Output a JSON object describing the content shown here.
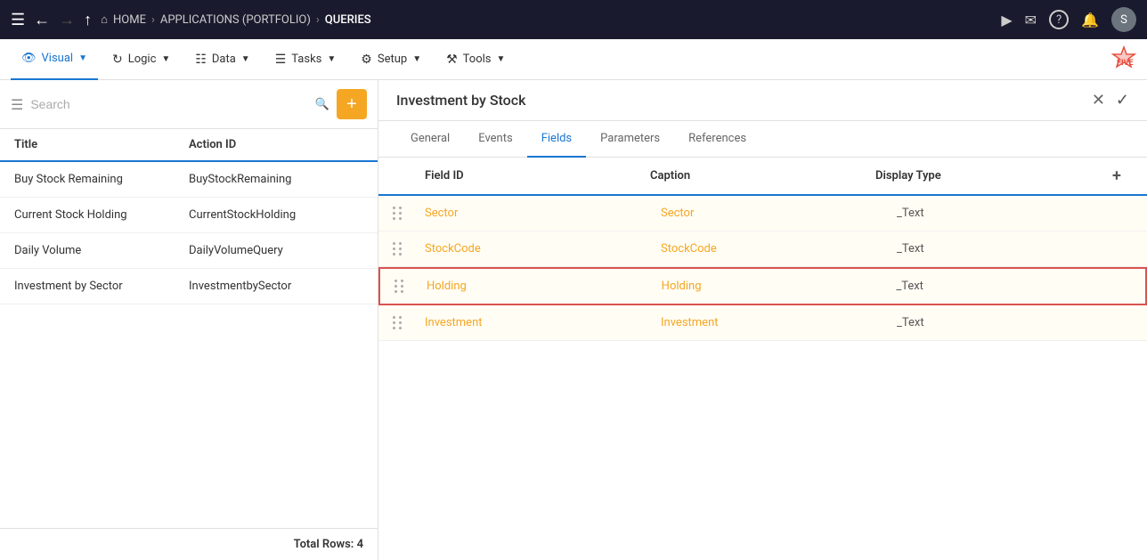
{
  "topNav": {
    "breadcrumbs": [
      {
        "label": "HOME",
        "active": false
      },
      {
        "label": "APPLICATIONS (PORTFOLIO)",
        "active": false
      },
      {
        "label": "QUERIES",
        "active": true
      }
    ],
    "userInitial": "S"
  },
  "secNav": {
    "items": [
      {
        "id": "visual",
        "label": "Visual",
        "icon": "eye",
        "active": true
      },
      {
        "id": "logic",
        "label": "Logic",
        "icon": "logic",
        "active": false
      },
      {
        "id": "data",
        "label": "Data",
        "icon": "data",
        "active": false
      },
      {
        "id": "tasks",
        "label": "Tasks",
        "icon": "tasks",
        "active": false
      },
      {
        "id": "setup",
        "label": "Setup",
        "icon": "gear",
        "active": false
      },
      {
        "id": "tools",
        "label": "Tools",
        "icon": "tools",
        "active": false
      }
    ]
  },
  "sidebar": {
    "searchPlaceholder": "Search",
    "columns": [
      {
        "id": "title",
        "label": "Title"
      },
      {
        "id": "action",
        "label": "Action ID"
      }
    ],
    "rows": [
      {
        "title": "Buy Stock Remaining",
        "actionId": "BuyStockRemaining"
      },
      {
        "title": "Current Stock Holding",
        "actionId": "CurrentStockHolding"
      },
      {
        "title": "Daily Volume",
        "actionId": "DailyVolumeQuery"
      },
      {
        "title": "Investment by Sector",
        "actionId": "InvestmentbySector"
      }
    ],
    "totalRows": "Total Rows: 4"
  },
  "detail": {
    "title": "Investment by Stock",
    "tabs": [
      {
        "id": "general",
        "label": "General",
        "active": false
      },
      {
        "id": "events",
        "label": "Events",
        "active": false
      },
      {
        "id": "fields",
        "label": "Fields",
        "active": true
      },
      {
        "id": "parameters",
        "label": "Parameters",
        "active": false
      },
      {
        "id": "references",
        "label": "References",
        "active": false
      }
    ],
    "fieldsColumns": [
      {
        "id": "fieldId",
        "label": "Field ID"
      },
      {
        "id": "caption",
        "label": "Caption"
      },
      {
        "id": "displayType",
        "label": "Display Type"
      }
    ],
    "fields": [
      {
        "fieldId": "Sector",
        "caption": "Sector",
        "displayType": "_Text",
        "selected": false
      },
      {
        "fieldId": "StockCode",
        "caption": "StockCode",
        "displayType": "_Text",
        "selected": false
      },
      {
        "fieldId": "Holding",
        "caption": "Holding",
        "displayType": "_Text",
        "selected": true
      },
      {
        "fieldId": "Investment",
        "caption": "Investment",
        "displayType": "_Text",
        "selected": false
      }
    ]
  }
}
